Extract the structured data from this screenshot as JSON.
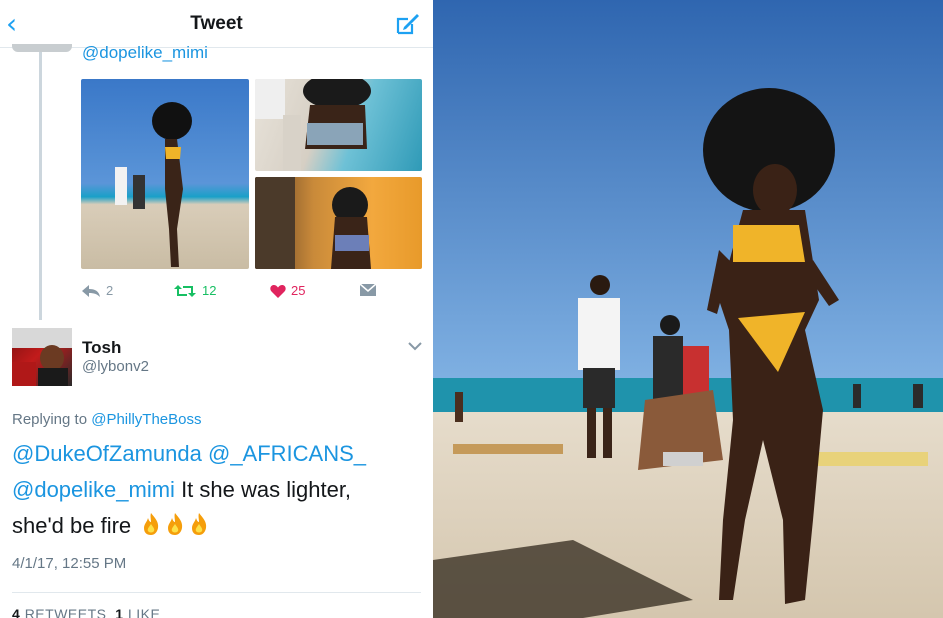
{
  "navbar": {
    "title": "Tweet",
    "back_icon": "chevron-left-icon",
    "compose_icon": "compose-icon"
  },
  "parent_tweet": {
    "handle": "@dopelike_mimi",
    "actions": {
      "replies": "2",
      "retweets": "12",
      "likes": "25"
    }
  },
  "reply_tweet": {
    "author_name": "Tosh",
    "author_handle": "@lybonv2",
    "replying_prefix": "Replying to",
    "replying_to": "@PhillyTheBoss",
    "mention_1": "@DukeOfZamunda",
    "mention_2": "@_AFRICANS_",
    "mention_3": "@dopelike_mimi",
    "text_1": " It she was lighter,",
    "text_2": "she'd be fire",
    "timestamp": "4/1/17, 12:55 PM",
    "retweets_count": "4",
    "retweets_label": "RETWEETS",
    "likes_count": "1",
    "likes_label": "LIKE"
  },
  "colors": {
    "accent": "#1da1f2",
    "link": "#1b95e0",
    "retweet": "#17bf63",
    "like": "#e0245e",
    "muted": "#657786"
  }
}
